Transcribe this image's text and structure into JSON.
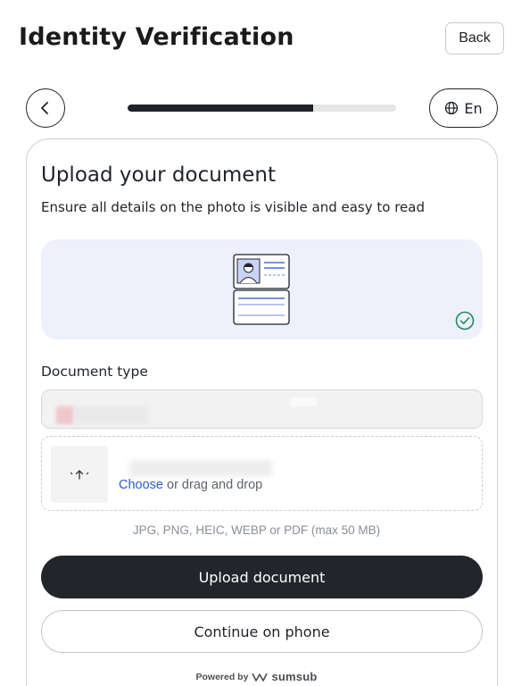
{
  "header": {
    "title": "Identity Verification",
    "back_label": "Back"
  },
  "nav": {
    "progress_fraction": 0.69,
    "language_label": "En"
  },
  "card": {
    "title": "Upload your document",
    "subtitle": "Ensure all details on the photo is visible and easy to read",
    "document_type_label": "Document type",
    "dropzone": {
      "link_text": "Choose",
      "rest_text": " or drag and drop"
    },
    "formats_text": "JPG, PNG, HEIC, WEBP or PDF (max 50 MB)",
    "upload_button_label": "Upload document",
    "phone_button_label": "Continue on phone",
    "powered_by": "Powered by",
    "brand": "sumsub"
  },
  "colors": {
    "primary": "#22262b",
    "link": "#2e5ac9",
    "illustration_bg": "#eef1fc",
    "success": "#1f8a5b"
  },
  "icons": [
    "chevron-left-icon",
    "globe-icon",
    "id-document-icon",
    "check-circle-icon",
    "upload-icon",
    "sumsub-logo-icon"
  ]
}
